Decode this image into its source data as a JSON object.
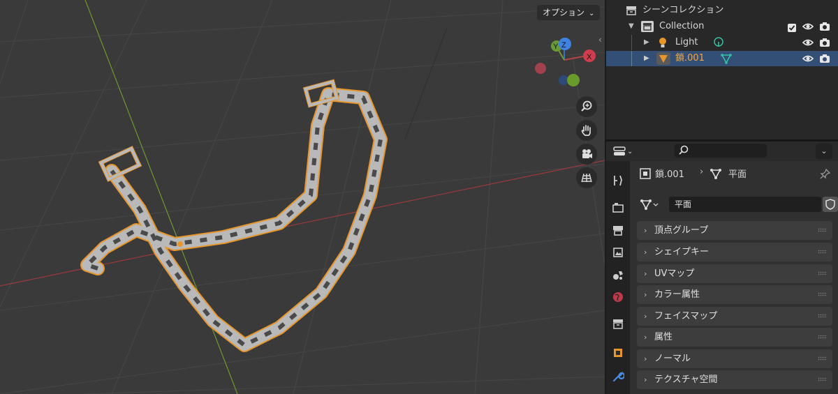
{
  "viewport": {
    "options_label": "オプション",
    "gizmo": {
      "y": "Y",
      "z": "Z",
      "x": "X"
    },
    "nav_icons": [
      "zoom-icon",
      "hand-icon",
      "camera-icon",
      "grid-icon"
    ]
  },
  "outliner": {
    "scene_collection": "シーンコレクション",
    "rows": [
      {
        "label": "Collection"
      },
      {
        "label": "Light"
      },
      {
        "label": "鎖.001"
      }
    ]
  },
  "properties": {
    "breadcrumb_object": "鎖.001",
    "breadcrumb_mesh": "平面",
    "mesh_name": "平面",
    "panels": [
      {
        "label": "頂点グループ"
      },
      {
        "label": "シェイプキー"
      },
      {
        "label": "UVマップ"
      },
      {
        "label": "カラー属性"
      },
      {
        "label": "フェイスマップ"
      },
      {
        "label": "属性"
      },
      {
        "label": "ノーマル"
      },
      {
        "label": "テクスチャ空間"
      }
    ]
  },
  "colors": {
    "selection_outline": "#e8962c",
    "chain_body": "#b9b9b9",
    "selected_row": "#334f75",
    "axis_x": "#9b3a3a",
    "axis_y": "#6d9a2f"
  }
}
